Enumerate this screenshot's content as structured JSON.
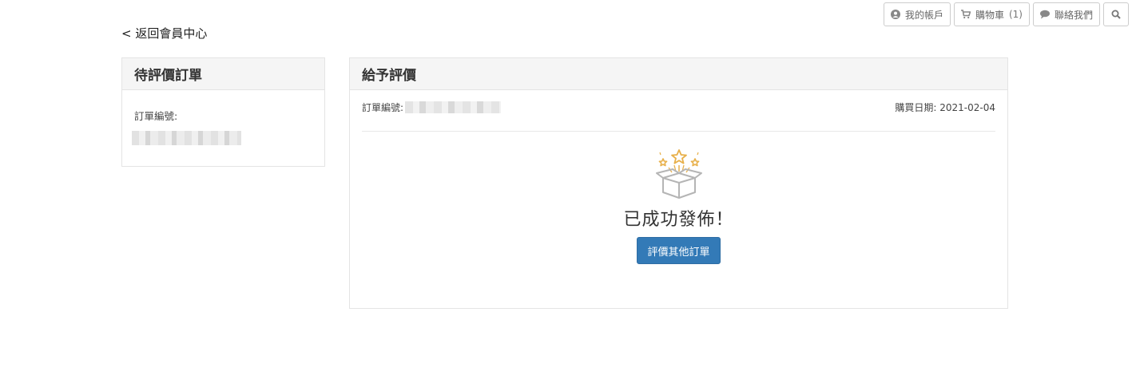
{
  "topbar": {
    "account": {
      "label": "我的帳戶",
      "icon": "user-circle-icon"
    },
    "cart": {
      "label": "購物車",
      "count": "(1)",
      "icon": "cart-icon"
    },
    "contact": {
      "label": "聯絡我們",
      "icon": "chat-bubble-icon"
    },
    "search": {
      "icon": "search-icon"
    }
  },
  "back_link": "< 返回會員中心",
  "left_panel": {
    "title": "待評價訂單",
    "order_label": "訂單編號:"
  },
  "right_panel": {
    "title": "給予評價",
    "order_label": "訂單編號:",
    "purchase_date": "購買日期: 2021-02-04",
    "success_message": "已成功發佈！",
    "rate_other_button": "評價其他訂單",
    "success_icon": "gift-box-stars-icon"
  },
  "colors": {
    "primary_button": "#337ab7",
    "star_accent": "#e8b04a",
    "panel_header_bg": "#f5f5f5"
  }
}
